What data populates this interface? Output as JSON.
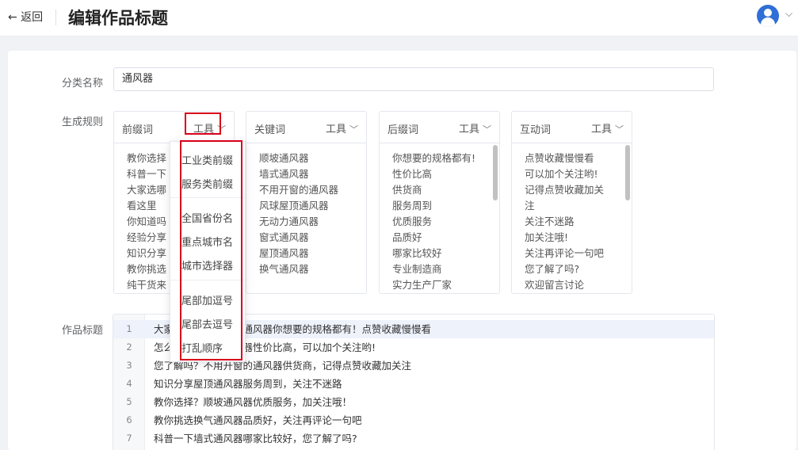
{
  "header": {
    "back_label": "← 返回",
    "title": "编辑作品标题"
  },
  "form": {
    "category_label": "分类名称",
    "category_value": "通风器",
    "rules_label": "生成规则",
    "works_label": "作品标题"
  },
  "columns": [
    {
      "title": "前缀词",
      "tool_label": "工具",
      "items": [
        "教你选择",
        "科普一下",
        "大家选哪",
        "看这里",
        "你知道吗",
        "经验分享",
        "知识分享",
        "教你挑选",
        "纯干货来"
      ]
    },
    {
      "title": "关键词",
      "tool_label": "工具",
      "items": [
        "顺坡通风器",
        "墙式通风器",
        "不用开窗的通风器",
        "风球屋顶通风器",
        "无动力通风器",
        "窗式通风器",
        "屋顶通风器",
        "换气通风器"
      ]
    },
    {
      "title": "后缀词",
      "tool_label": "工具",
      "items": [
        "你想要的规格都有!",
        "性价比高",
        "供货商",
        "服务周到",
        "优质服务",
        "品质好",
        "哪家比较好",
        "专业制造商",
        "实力生产厂家"
      ]
    },
    {
      "title": "互动词",
      "tool_label": "工具",
      "items": [
        "点赞收藏慢慢看",
        "可以加个关注哟!",
        "记得点赞收藏加关",
        "注",
        "关注不迷路",
        "加关注哦!",
        "关注再评论一句吧",
        "您了解了吗?",
        "欢迎留言讨论"
      ]
    }
  ],
  "dropdown": {
    "items": [
      "工业类前缀",
      "服务类前缀",
      "全国省份名",
      "重点城市名",
      "城市选择器",
      "尾部加逗号",
      "尾部去逗号",
      "打乱顺序"
    ]
  },
  "works": {
    "lines": [
      {
        "n": "1",
        "text": "大家选哪不用开窗的通风器你想要的规格都有！点赞收藏慢慢看"
      },
      {
        "n": "2",
        "text": "怎么选风球屋顶通风器性价比高，可以加个关注哟!"
      },
      {
        "n": "3",
        "text": "您了解吗？不用开窗的通风器供货商，记得点赞收藏加关注"
      },
      {
        "n": "4",
        "text": "知识分享屋顶通风器服务周到，关注不迷路"
      },
      {
        "n": "5",
        "text": "教你选择？顺坡通风器优质服务，加关注哦！"
      },
      {
        "n": "6",
        "text": "教你挑选换气通风器品质好，关注再评论一句吧"
      },
      {
        "n": "7",
        "text": "科普一下墙式通风器哪家比较好，您了解了吗?"
      }
    ]
  },
  "colors": {
    "highlight": "#d9001b",
    "avatar": "#2f6fd6",
    "active_row": "#eef2fb"
  }
}
